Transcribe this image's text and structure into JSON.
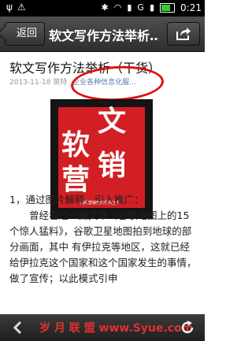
{
  "status_bar": {
    "icons": [
      "usb-icon",
      "debug-icon",
      "bluetooth-icon",
      "wifi-icon",
      "signal-icon",
      "network-g-icon",
      "signal-icon",
      "battery-icon"
    ],
    "network_label": "G",
    "time": "0:21"
  },
  "header": {
    "back_label": "返回",
    "title": "软文写作方法举析…",
    "share_icon": "share-icon"
  },
  "article": {
    "title": "软文写作方法举析（干货）",
    "date": "2013-11-18",
    "author": "英特",
    "category_link": "企业各种信息化服…",
    "cover": {
      "word1": "软",
      "word2": "文",
      "word3": "营",
      "word4": "销",
      "caption": "网络营销指南系列丛书"
    },
    "section_heading": "1，通过图片解释，引入推广：",
    "body": "曾经看过一篇文章《谷歌地图上的15个惊人猛料》，谷歌卫星地图拍到地球的部分画面，其中 有伊拉克等地区，这就已经给伊拉克这个国家和这个国家发生的事情，做了宣传；以此模式引申"
  },
  "bottom_bar": {
    "watermark": "岁 月 联 盟   www.Syue.com",
    "back_icon": "back-arrow-icon",
    "refresh_icon": "refresh-icon"
  },
  "colors": {
    "accent_red": "#e01010",
    "link_blue": "#5a7db0",
    "bar_dark": "#333333"
  }
}
